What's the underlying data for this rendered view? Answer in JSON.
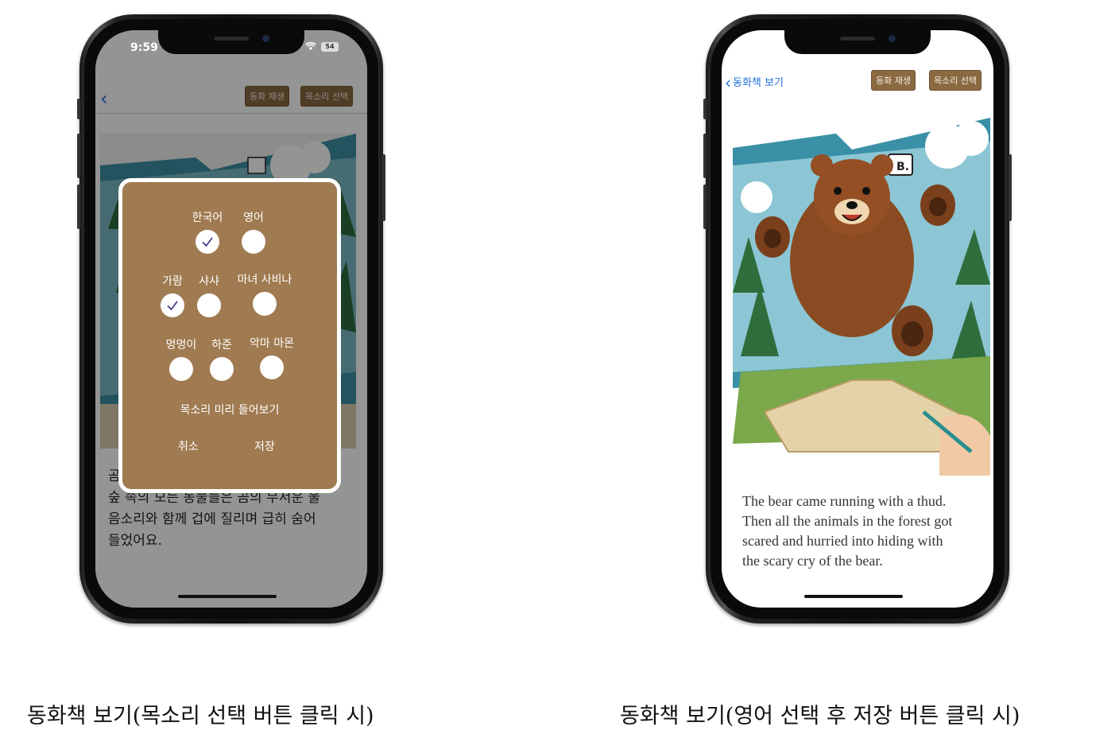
{
  "left_screen": {
    "status": {
      "time": "9:59",
      "battery": "54"
    },
    "navbar": {
      "play_label": "동화 재생",
      "voice_label": "목소리 선택"
    },
    "story_text": [
      "곰",
      "숲 속의 모든 동물들은 곰의 무서운 울",
      "음소리와 함께 겁에 질리며 급히 숨어",
      "들었어요."
    ],
    "modal": {
      "language_options": [
        {
          "label": "한국어",
          "checked": true
        },
        {
          "label": "영어",
          "checked": false
        }
      ],
      "voice_options_row1": [
        {
          "label": "가람",
          "checked": true
        },
        {
          "label": "샤샤",
          "checked": false
        },
        {
          "label": "마녀 사비나",
          "checked": false
        }
      ],
      "voice_options_row2": [
        {
          "label": "멍멍이",
          "checked": false
        },
        {
          "label": "하준",
          "checked": false
        },
        {
          "label": "악마 마몬",
          "checked": false
        }
      ],
      "preview_label": "목소리 미리 들어보기",
      "cancel_label": "취소",
      "save_label": "저장"
    }
  },
  "right_screen": {
    "navbar": {
      "back_label": "동화책 보기",
      "play_label": "동화 재생",
      "voice_label": "목소리 선택"
    },
    "illustration_sign": "B.",
    "story_text": [
      "The bear came running with a thud.",
      "Then all the animals in the forest got",
      "scared and hurried into hiding with",
      "the scary cry of the bear."
    ]
  },
  "captions": {
    "left": "동화책 보기(목소리 선택 버튼 클릭 시)",
    "right": "동화책 보기(영어 선택 후 저장 버튼 클릭 시)"
  },
  "colors": {
    "accent_brown": "#a07a50",
    "button_brown": "#8b6a42",
    "link_blue": "#1e6fd9",
    "check_purple": "#4a3a8c"
  }
}
